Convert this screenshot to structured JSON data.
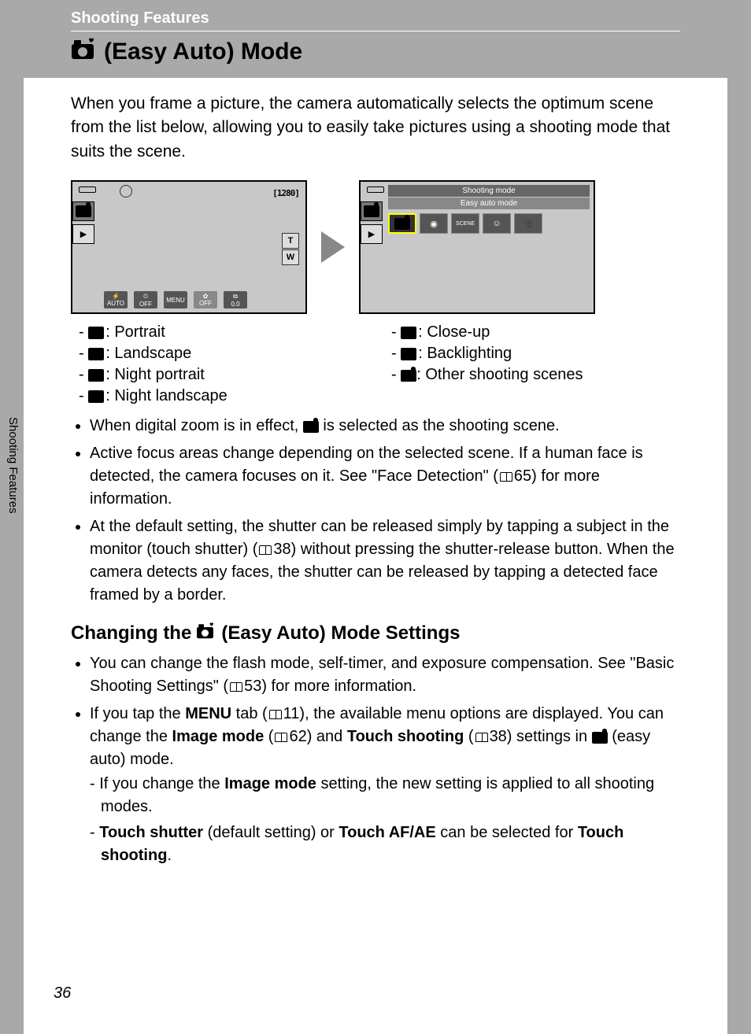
{
  "breadcrumb": "Shooting Features",
  "title_text": "(Easy Auto) Mode",
  "intro": "When you frame a picture, the camera automatically selects the optimum scene from the list below, allowing you to easily take pictures using a shooting mode that suits the scene.",
  "screen1": {
    "remaining": "[1280]",
    "zoom_t": "T",
    "zoom_w": "W",
    "auto": "AUTO",
    "off": "OFF",
    "menu": "MENU",
    "ev": "0.0"
  },
  "screen2": {
    "bar1": "Shooting mode",
    "bar2": "Easy auto mode",
    "scene": "SCENE"
  },
  "scenes_left": [
    ": Portrait",
    ": Landscape",
    ": Night portrait",
    ": Night landscape"
  ],
  "scenes_right": [
    ": Close-up",
    ": Backlighting",
    ": Other shooting scenes"
  ],
  "notes": {
    "n1a": "When digital zoom is in effect, ",
    "n1b": " is selected as the shooting scene.",
    "n2a": "Active focus areas change depending on the selected scene. If a human face is detected, the camera focuses on it. See \"Face Detection\" (",
    "n2b": "65) for more information.",
    "n3a": "At the default setting, the shutter can be released simply by tapping a subject in the monitor (touch shutter) (",
    "n3b": "38) without pressing the shutter-release button. When the camera detects any faces, the shutter can be released by tapping a detected face framed by a border."
  },
  "sect2_a": "Changing the ",
  "sect2_b": " (Easy Auto) Mode Settings",
  "settings": {
    "s1a": "You can change the flash mode, self-timer, and exposure compensation. See \"Basic Shooting Settings\" (",
    "s1b": "53) for more information.",
    "s2a": "If you tap the ",
    "s2menu": "MENU",
    "s2b": " tab (",
    "s2c": "11), the available menu options are displayed. You can change the ",
    "s2_im": "Image mode",
    "s2d": " (",
    "s2e": "62) and ",
    "s2_ts": "Touch shooting",
    "s2f": " (",
    "s2g": "38) settings in ",
    "s2h": " (easy auto) mode.",
    "sub1a": "If you change the ",
    "sub1_im": "Image mode",
    "sub1b": " setting, the new setting is applied to all shooting modes.",
    "sub2_ts": "Touch shutter",
    "sub2a": " (default setting) or ",
    "sub2_taf": "Touch AF/AE",
    "sub2b": " can be selected for ",
    "sub2_tsh": "Touch shooting",
    "sub2c": "."
  },
  "side_label": "Shooting Features",
  "page_number": "36"
}
